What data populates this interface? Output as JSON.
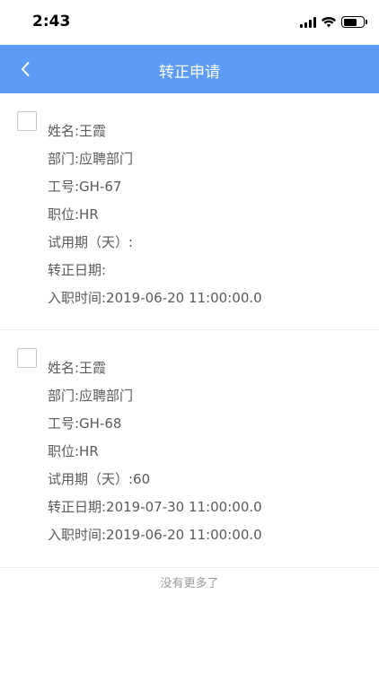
{
  "status_bar": {
    "time": "2:43"
  },
  "nav": {
    "title": "转正申请",
    "back_icon": "chevron-left-icon"
  },
  "records": [
    {
      "name": "姓名:王霞",
      "department": "部门:应聘部门",
      "employee_id": "工号:GH-67",
      "position": "职位:HR",
      "probation_days": "试用期（天）:",
      "regular_date": "转正日期:",
      "hire_time": "入职时间:2019-06-20 11:00:00.0"
    },
    {
      "name": "姓名:王霞",
      "department": "部门:应聘部门",
      "employee_id": "工号:GH-68",
      "position": "职位:HR",
      "probation_days": "试用期（天）:60",
      "regular_date": "转正日期:2019-07-30 11:00:00.0",
      "hire_time": "入职时间:2019-06-20 11:00:00.0"
    }
  ],
  "footer": {
    "no_more": "没有更多了"
  },
  "colors": {
    "nav_background": "#5c9cf4",
    "field_text": "#5a5a5a"
  }
}
